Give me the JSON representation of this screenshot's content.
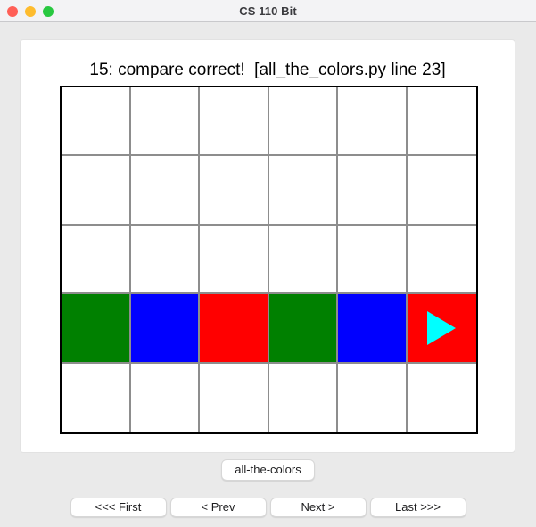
{
  "window": {
    "title": "CS 110 Bit",
    "traffic_lights": [
      {
        "name": "close",
        "color": "#ff5f57"
      },
      {
        "name": "minimize",
        "color": "#febc2e"
      },
      {
        "name": "maximize",
        "color": "#28c840"
      }
    ]
  },
  "content": {
    "heading": "15: compare correct!  [all_the_colors.py line 23]"
  },
  "grid": {
    "columns": 6,
    "rows": 5,
    "border_color": "#000000",
    "line_color": "#8d8d8d",
    "empty_color": "#ffffff",
    "palette": {
      "green": "#008000",
      "blue": "#0000ff",
      "red": "#ff0000",
      "white": "#ffffff"
    },
    "cells": [
      [
        "white",
        "white",
        "white",
        "white",
        "white",
        "white"
      ],
      [
        "white",
        "white",
        "white",
        "white",
        "white",
        "white"
      ],
      [
        "white",
        "white",
        "white",
        "white",
        "white",
        "white"
      ],
      [
        "green",
        "blue",
        "red",
        "green",
        "blue",
        "red"
      ],
      [
        "white",
        "white",
        "white",
        "white",
        "white",
        "white"
      ]
    ],
    "bit": {
      "row": 3,
      "column": 5,
      "direction": "right",
      "color": "#00ffff"
    }
  },
  "controls": {
    "tab_label": "all-the-colors",
    "nav_buttons": [
      {
        "label": "<<< First"
      },
      {
        "label": "< Prev"
      },
      {
        "label": "Next >"
      },
      {
        "label": "Last >>>"
      }
    ]
  }
}
